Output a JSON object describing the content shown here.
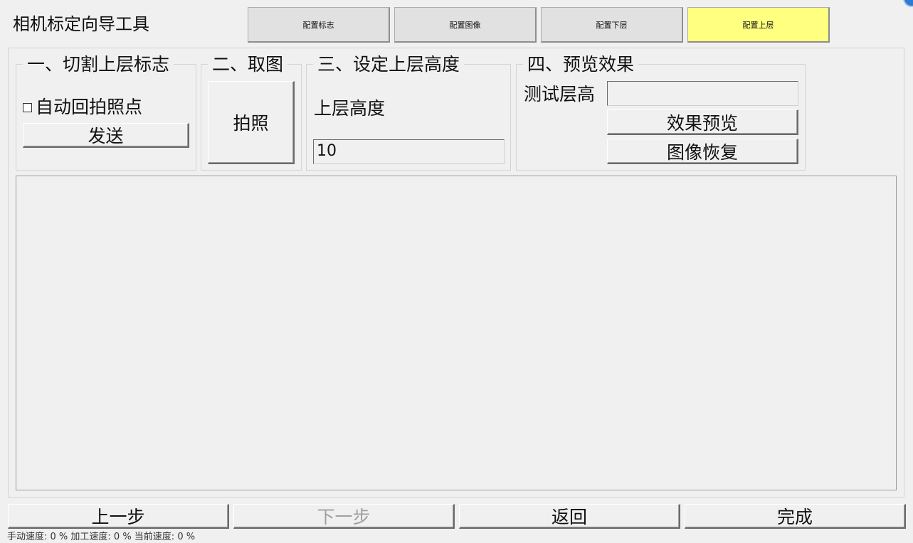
{
  "app": {
    "title": "相机标定向导工具"
  },
  "top_tabs": [
    {
      "label": "配置标志",
      "active": false
    },
    {
      "label": "配置图像",
      "active": false
    },
    {
      "label": "配置下层",
      "active": false
    },
    {
      "label": "配置上层",
      "active": true
    }
  ],
  "colors": {
    "active_tab": "#ffff80",
    "background": "#f0f0f0"
  },
  "section1": {
    "title": "一、切割上层标志",
    "checkbox_label": "自动回拍照点",
    "checkbox_checked": false,
    "send_label": "发送"
  },
  "section2": {
    "title": "二、取图",
    "capture_label": "拍照"
  },
  "section3": {
    "title": "三、设定上层高度",
    "height_label": "上层高度",
    "height_value": "10"
  },
  "section4": {
    "title": "四、预览效果",
    "test_label": "测试层高",
    "test_value": "",
    "preview_label": "效果预览",
    "restore_label": "图像恢复"
  },
  "footer": {
    "prev_label": "上一步",
    "next_label": "下一步",
    "back_label": "返回",
    "finish_label": "完成",
    "status_text": "手动速度: 0 %   加工速度: 0 %   当前速度: 0 %"
  }
}
